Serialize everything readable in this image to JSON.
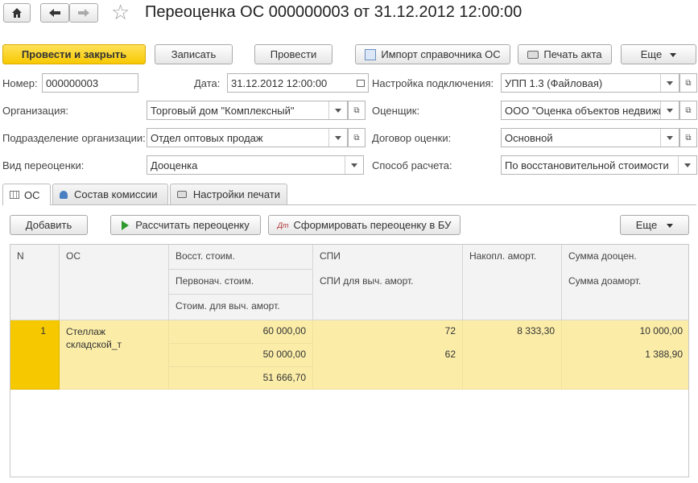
{
  "title": "Переоценка ОС 000000003 от 31.12.2012 12:00:00",
  "toolbar": {
    "post_close": "Провести и закрыть",
    "save": "Записать",
    "post": "Провести",
    "import": "Импорт справочника ОС",
    "print": "Печать акта",
    "more": "Еще"
  },
  "form": {
    "number_label": "Номер:",
    "number_value": "000000003",
    "date_label": "Дата:",
    "date_value": "31.12.2012 12:00:00",
    "conn_label": "Настройка подключения:",
    "conn_value": "УПП 1.3 (Файловая)",
    "org_label": "Организация:",
    "org_value": "Торговый дом \"Комплексный\"",
    "appraiser_label": "Оценщик:",
    "appraiser_value": "ООО \"Оценка объектов недвижи",
    "dept_label": "Подразделение организации:",
    "dept_value": "Отдел оптовых продаж",
    "contract_label": "Договор оценки:",
    "contract_value": "Основной",
    "type_label": "Вид переоценки:",
    "type_value": "Дооценка",
    "method_label": "Способ расчета:",
    "method_value": "По восстановительной стоимости"
  },
  "tabs": [
    "ОС",
    "Состав комиссии",
    "Настройки печати"
  ],
  "table_toolbar": {
    "add": "Добавить",
    "calc": "Рассчитать переоценку",
    "form_bu": "Сформировать переоценку в БУ",
    "more": "Еще"
  },
  "table": {
    "headers": {
      "n": "N",
      "os": "ОС",
      "restore_cost": "Восст. стоим.",
      "initial_cost": "Первонач. стоим.",
      "amort_cost": "Стоим. для выч. аморт.",
      "spi": "СПИ",
      "spi_amort": "СПИ для выч. аморт.",
      "accum_amort": "Накопл. аморт.",
      "sum_reval": "Сумма дооцен.",
      "sum_amort": "Сумма доаморт."
    },
    "rows": [
      {
        "n": "1",
        "os": "Стеллаж складской_т",
        "restore_cost": "60 000,00",
        "initial_cost": "50 000,00",
        "amort_cost": "51 666,70",
        "spi": "72",
        "spi_amort": "62",
        "accum_amort": "8 333,30",
        "sum_reval": "10 000,00",
        "sum_amort": "1 388,90"
      }
    ]
  }
}
